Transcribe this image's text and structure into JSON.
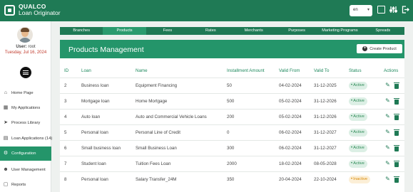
{
  "app": {
    "brand": "QUALCO",
    "product": "Loan Originator"
  },
  "header": {
    "language": "en",
    "icons": [
      "square-icon",
      "sliders-icon",
      "logout-icon"
    ]
  },
  "user": {
    "label": "User:",
    "name": "root",
    "date": "Tuesday, Jul 16, 2024"
  },
  "sidebar": {
    "items": [
      {
        "label": "Home Page",
        "icon": "home-icon",
        "active": false
      },
      {
        "label": "My Applications",
        "icon": "folder-icon",
        "active": false
      },
      {
        "label": "Process Library",
        "icon": "process-icon",
        "active": false
      },
      {
        "label": "Loan Applications (14)",
        "icon": "list-icon",
        "active": false
      },
      {
        "label": "Configuration",
        "icon": "gear-icon",
        "active": true
      },
      {
        "label": "User Management",
        "icon": "user-icon",
        "active": false
      },
      {
        "label": "Reports",
        "icon": "report-icon",
        "active": false
      }
    ]
  },
  "tabs": [
    {
      "label": "Branches",
      "active": false
    },
    {
      "label": "Products",
      "active": true
    },
    {
      "label": "Fees",
      "active": false
    },
    {
      "label": "Rates",
      "active": false
    },
    {
      "label": "Merchants",
      "active": false
    },
    {
      "label": "Purposes",
      "active": false
    },
    {
      "label": "Marketing Programs",
      "active": false
    },
    {
      "label": "Spreads",
      "active": false
    }
  ],
  "main": {
    "title": "Products Management",
    "create_label": "Create Product",
    "columns": [
      "ID",
      "Loan",
      "Name",
      "Installment Amount",
      "Valid From",
      "Valid To",
      "Status",
      "Actions"
    ],
    "rows": [
      {
        "id": "2",
        "loan": "Business loan",
        "name": "Equipment Financing",
        "amount": "50",
        "from": "04-02-2024",
        "to": "31-12-2025",
        "status": "Active"
      },
      {
        "id": "3",
        "loan": "Mortgage loan",
        "name": "Home Mortgage",
        "amount": "500",
        "from": "05-02-2024",
        "to": "31-12-2026",
        "status": "Active"
      },
      {
        "id": "4",
        "loan": "Auto loan",
        "name": "Auto and Commercial Vehicle Loans",
        "amount": "200",
        "from": "05-02-2024",
        "to": "31-12-2026",
        "status": "Active"
      },
      {
        "id": "5",
        "loan": "Personal loan",
        "name": "Personal Line of Credit",
        "amount": "0",
        "from": "06-02-2024",
        "to": "31-12-2027",
        "status": "Active"
      },
      {
        "id": "6",
        "loan": "Small business loan",
        "name": "Small Business Loan",
        "amount": "300",
        "from": "06-02-2024",
        "to": "31-12-2027",
        "status": "Active"
      },
      {
        "id": "7",
        "loan": "Student loan",
        "name": "Tuition Fees Loan",
        "amount": "2000",
        "from": "18-02-2024",
        "to": "08-05-2028",
        "status": "Active"
      },
      {
        "id": "8",
        "loan": "Personal loan",
        "name": "Salary Transfer_24M",
        "amount": "350",
        "from": "20-04-2024",
        "to": "22-10-2024",
        "status": "Inactive"
      }
    ]
  },
  "colors": {
    "brand": "#1f7a55",
    "accent": "#24956a",
    "active_badge": "#2e8b57",
    "inactive_badge": "#d98b0a"
  }
}
